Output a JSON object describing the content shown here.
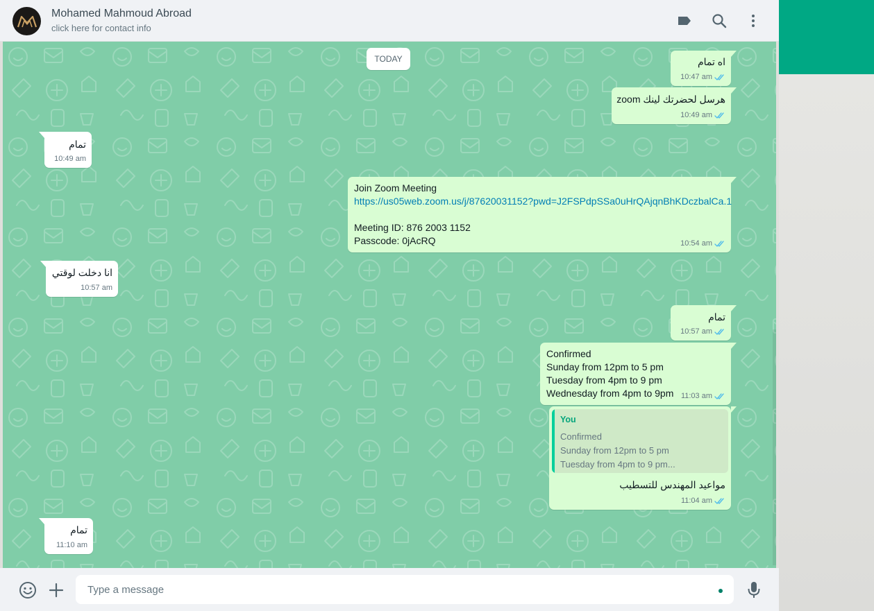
{
  "header": {
    "contact_name": "Mohamed Mahmoud Abroad",
    "contact_subtitle": "click here for contact info",
    "icons": [
      "label-icon",
      "search-icon",
      "menu-icon"
    ]
  },
  "conversation": {
    "date_divider": "TODAY",
    "messages": [
      {
        "direction": "outgoing",
        "text": "اه تمام",
        "time": "10:47 am",
        "status": "read"
      },
      {
        "direction": "outgoing",
        "text": "هرسل لحضرتك لينك zoom",
        "time": "10:49 am",
        "status": "read"
      },
      {
        "direction": "incoming",
        "text": "تمام",
        "time": "10:49 am"
      },
      {
        "direction": "outgoing",
        "lines": [
          "Join Zoom Meeting",
          "https://us05web.zoom.us/j/87620031152?pwd=J2FSPdpSSa0uHrQAjqnBhKDczbalCa.1",
          "Meeting ID: 876 2003 1152",
          "Passcode: 0jAcRQ"
        ],
        "time": "10:54 am",
        "status": "read"
      },
      {
        "direction": "incoming",
        "text": "انا دخلت لوقتي",
        "time": "10:57 am"
      },
      {
        "direction": "outgoing",
        "text": "تمام",
        "time": "10:57 am",
        "status": "read"
      },
      {
        "direction": "outgoing",
        "lines": [
          "Confirmed",
          "Sunday from 12pm to 5 pm",
          "Tuesday from 4pm to 9 pm",
          "Wednesday from 4pm to 9pm"
        ],
        "time": "11:03 am",
        "status": "read"
      },
      {
        "direction": "outgoing",
        "quote": {
          "author": "You",
          "lines": [
            "Confirmed",
            "Sunday from 12pm to 5 pm",
            "Tuesday from 4pm to 9 pm..."
          ]
        },
        "text": "مواعيد المهندس للتسطيب",
        "time": "11:04 am",
        "status": "read"
      },
      {
        "direction": "incoming",
        "text": "تمام",
        "time": "11:10 am"
      }
    ]
  },
  "composer": {
    "placeholder": "Type a message",
    "icons": [
      "emoji-icon",
      "attach-icon",
      "microphone-icon"
    ]
  },
  "colors": {
    "chat_background": "#80cda8",
    "outgoing_bubble": "#d9fdd3",
    "incoming_bubble": "#ffffff",
    "accent": "#00a884",
    "read_ticks": "#53bdeb",
    "link": "#027eb5"
  }
}
